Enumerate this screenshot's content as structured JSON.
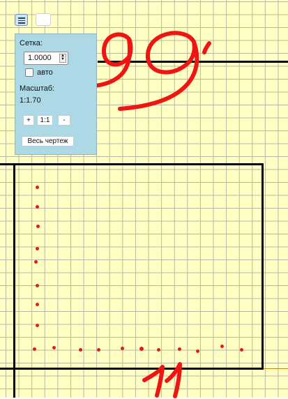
{
  "panel": {
    "grid_label": "Сетка:",
    "grid_value": "1.0000",
    "auto_label": "авто",
    "scale_label": "Масштаб:",
    "scale_value": "1:1.70",
    "zoom_in_label": "+",
    "reset_label": "1:1",
    "zoom_out_label": "-",
    "fit_label": "Весь чертеж"
  },
  "annotations": {
    "top_number": "99",
    "bottom_number": "11"
  },
  "colors": {
    "background": "#ffffc4",
    "grid_line": "#b7b7a4",
    "drawing_line": "#000000",
    "points": "#e41b1b",
    "panel_background": "#add8e6"
  }
}
